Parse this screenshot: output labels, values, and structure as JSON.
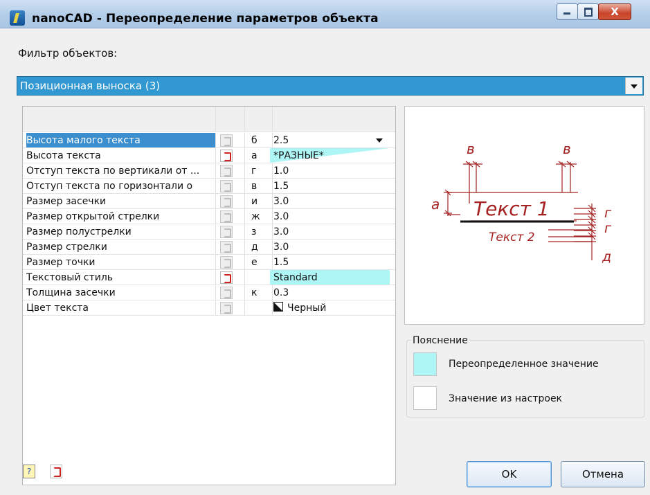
{
  "window": {
    "title": "nanoCAD - Переопределение параметров объекта",
    "close_glyph": "X"
  },
  "filter": {
    "label": "Фильтр объектов:",
    "selected": "Позиционная выноска (3)"
  },
  "grid": {
    "rows": [
      {
        "name": "Высота малого текста",
        "letter": "б",
        "value": "2.5",
        "state": "default",
        "selected": true,
        "dropdown": true
      },
      {
        "name": "Высота текста",
        "letter": "а",
        "value": "*РАЗНЫЕ*",
        "state": "partial"
      },
      {
        "name": "Отступ текста по вертикали от ...",
        "letter": "г",
        "value": "1.0",
        "state": "default"
      },
      {
        "name": "Отступ текста по горизонтали о",
        "letter": "в",
        "value": "1.5",
        "state": "default"
      },
      {
        "name": "Размер засечки",
        "letter": "и",
        "value": "3.0",
        "state": "default"
      },
      {
        "name": "Размер открытой стрелки",
        "letter": "ж",
        "value": "3.0",
        "state": "default"
      },
      {
        "name": "Размер полустрелки",
        "letter": "з",
        "value": "3.0",
        "state": "default"
      },
      {
        "name": "Размер стрелки",
        "letter": "д",
        "value": "3.0",
        "state": "default"
      },
      {
        "name": "Размер точки",
        "letter": "е",
        "value": "1.5",
        "state": "default"
      },
      {
        "name": "Текстовый стиль",
        "letter": "",
        "value": "Standard",
        "state": "override"
      },
      {
        "name": "Толщина засечки",
        "letter": "к",
        "value": "0.3",
        "state": "default"
      },
      {
        "name": "Цвет текста",
        "letter": "",
        "value": "Черный",
        "state": "default",
        "color_swatch": true
      }
    ]
  },
  "preview": {
    "text1": "Текст 1",
    "text2": "Текст 2",
    "labels": {
      "v_left": "в",
      "v_right": "в",
      "a": "а",
      "g_top": "г",
      "g_bottom": "г",
      "d": "д"
    },
    "line_color": "#a52020"
  },
  "legend": {
    "title": "Пояснение",
    "overridden": "Переопределенное значение",
    "from_settings": "Значение из настроек",
    "overridden_color": "#aef5f5"
  },
  "footer": {
    "help_glyph": "?",
    "ok": "OK",
    "cancel": "Отмена"
  }
}
